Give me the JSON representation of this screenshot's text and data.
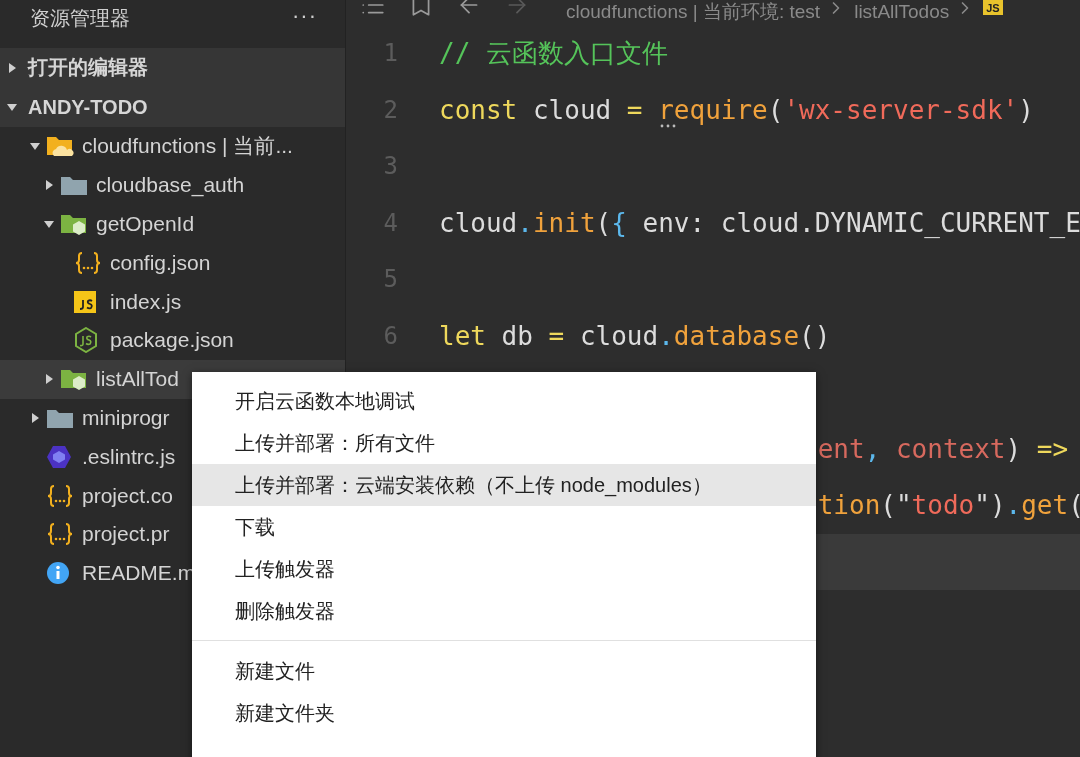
{
  "sidebar": {
    "title": "资源管理器",
    "more": "···",
    "sections": [
      {
        "title": "打开的编辑器",
        "expanded": false
      },
      {
        "title": "ANDY-TODO",
        "expanded": true,
        "children": [
          {
            "label": "cloudfunctions | 当前...",
            "kind": "cloud-folder",
            "expanded": true,
            "selected": false,
            "children": [
              {
                "label": "cloudbase_auth",
                "kind": "folder",
                "expanded": false,
                "selected": false
              },
              {
                "label": "getOpenId",
                "kind": "function-folder",
                "expanded": true,
                "selected": false,
                "children": [
                  {
                    "label": "config.json",
                    "kind": "json",
                    "selected": false
                  },
                  {
                    "label": "index.js",
                    "kind": "js",
                    "selected": false
                  },
                  {
                    "label": "package.json",
                    "kind": "node",
                    "selected": false
                  }
                ]
              },
              {
                "label": "listAllTod",
                "kind": "function-folder",
                "expanded": false,
                "selected": true
              }
            ]
          },
          {
            "label": "miniprogr",
            "kind": "folder",
            "expanded": false,
            "selected": false
          },
          {
            "label": ".eslintrc.js",
            "kind": "eslint",
            "selected": false
          },
          {
            "label": "project.co",
            "kind": "json",
            "selected": false
          },
          {
            "label": "project.pr",
            "kind": "json",
            "selected": false
          },
          {
            "label": "README.m",
            "kind": "info",
            "selected": false
          }
        ]
      }
    ]
  },
  "toolbar": {
    "buttons": [
      {
        "kind": "list",
        "disabled": false
      },
      {
        "kind": "bookmark",
        "disabled": false
      },
      {
        "kind": "back",
        "disabled": false
      },
      {
        "kind": "forward",
        "disabled": true
      }
    ],
    "breadcrumb": [
      "cloudfunctions | 当前环境: test",
      "listAllTodos"
    ],
    "file_badge": "JS"
  },
  "editor": {
    "lines": [
      {
        "number": "1",
        "tokens": [
          {
            "text": "// 云函数入口文件",
            "kind": "comment"
          }
        ]
      },
      {
        "number": "2",
        "tokens": [
          {
            "text": "const",
            "kind": "keyword"
          },
          {
            "text": " cloud ",
            "kind": "plain"
          },
          {
            "text": "= ",
            "kind": "keyword"
          },
          {
            "text": "require",
            "kind": "function",
            "hint": true
          },
          {
            "text": "(",
            "kind": "plain"
          },
          {
            "text": "'wx-server-sdk'",
            "kind": "string"
          },
          {
            "text": ")",
            "kind": "plain"
          }
        ]
      },
      {
        "number": "3"
      },
      {
        "number": "4",
        "tokens": [
          {
            "text": "cloud",
            "kind": "plain"
          },
          {
            "text": ".",
            "kind": "punct"
          },
          {
            "text": "init",
            "kind": "function"
          },
          {
            "text": "(",
            "kind": "plain"
          },
          {
            "text": "{",
            "kind": "punct"
          },
          {
            "text": " env: cloud.DYNAMIC_CURRENT_E",
            "kind": "plain"
          }
        ]
      },
      {
        "number": "5"
      },
      {
        "number": "6",
        "tokens": [
          {
            "text": "let",
            "kind": "keyword"
          },
          {
            "text": " db ",
            "kind": "plain"
          },
          {
            "text": "=",
            "kind": "keyword"
          },
          {
            "text": " cloud",
            "kind": "plain"
          },
          {
            "text": ".",
            "kind": "punct"
          },
          {
            "text": "database",
            "kind": "function"
          },
          {
            "text": "()",
            "kind": "plain"
          }
        ]
      },
      {
        "current": false
      },
      {
        "tokens": [
          {
            "text": "ent",
            "kind": "param"
          },
          {
            "text": ", ",
            "kind": "punct"
          },
          {
            "text": "context",
            "kind": "param"
          },
          {
            "text": ")",
            "kind": "plain"
          },
          {
            "text": " =>",
            "kind": "keyword"
          }
        ]
      },
      {
        "tokens": [
          {
            "text": "tion",
            "kind": "function"
          },
          {
            "text": "(\"",
            "kind": "plain"
          },
          {
            "text": "todo",
            "kind": "string"
          },
          {
            "text": "\")",
            "kind": "plain"
          },
          {
            "text": ".",
            "kind": "punct"
          },
          {
            "text": "get",
            "kind": "function"
          },
          {
            "text": "(",
            "kind": "plain"
          }
        ]
      },
      {
        "current": true
      }
    ]
  },
  "context_menu": {
    "groups": [
      [
        {
          "label": "开启云函数本地调试",
          "highlighted": false
        },
        {
          "label": "上传并部署：所有文件",
          "highlighted": false
        },
        {
          "label": "上传并部署：云端安装依赖（不上传 node_modules）",
          "highlighted": true
        },
        {
          "label": "下载",
          "highlighted": false
        },
        {
          "label": "上传触发器",
          "highlighted": false
        },
        {
          "label": "删除触发器",
          "highlighted": false
        }
      ],
      [
        {
          "label": "新建文件",
          "highlighted": false
        },
        {
          "label": "新建文件夹",
          "highlighted": false
        }
      ]
    ]
  }
}
